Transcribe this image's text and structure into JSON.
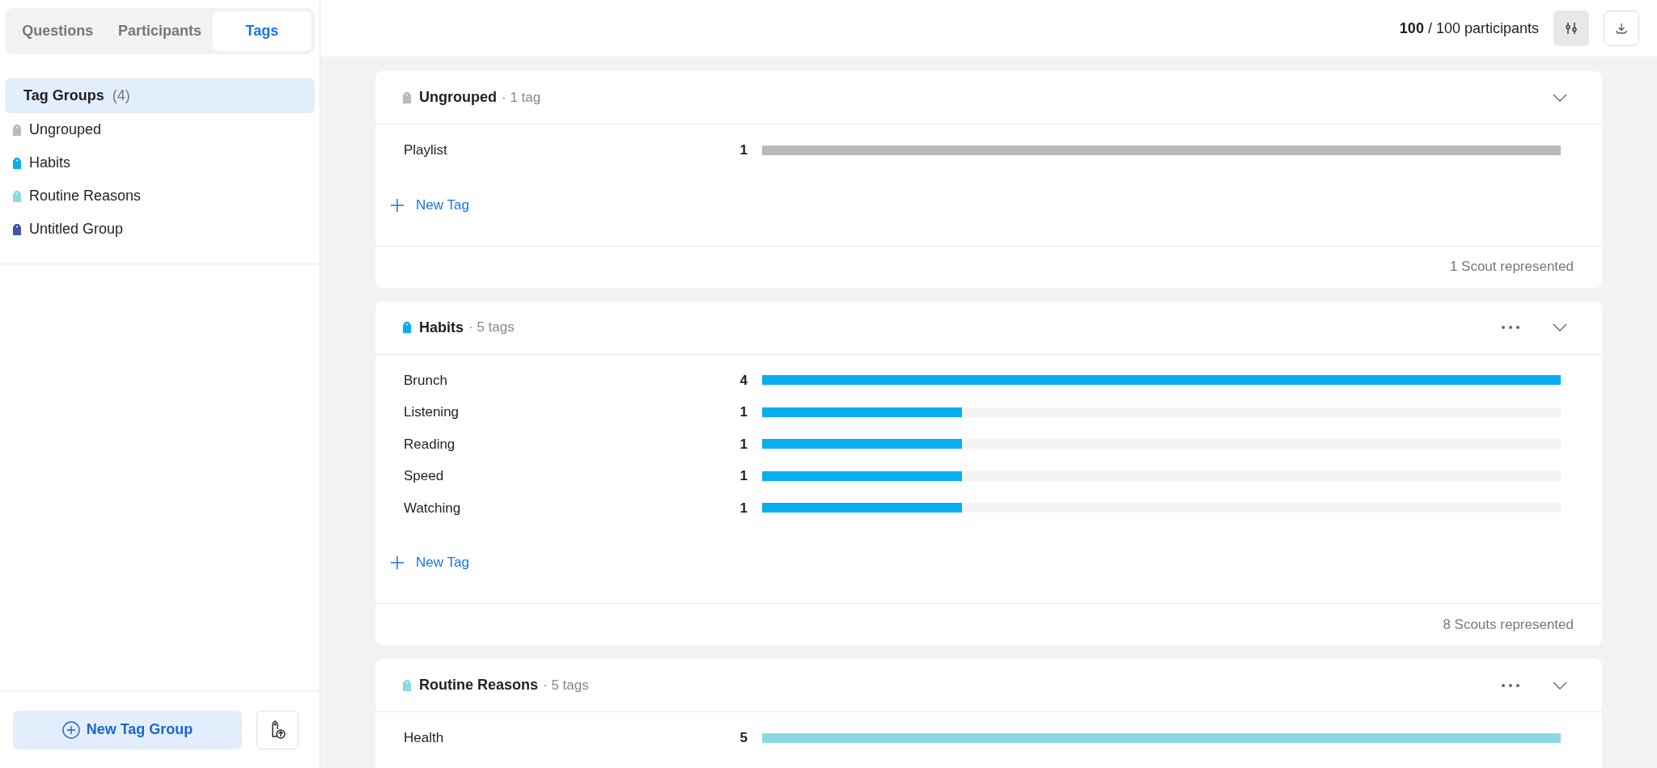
{
  "tabs": [
    {
      "label": "Questions",
      "selected": false
    },
    {
      "label": "Participants",
      "selected": false
    },
    {
      "label": "Tags",
      "selected": true
    }
  ],
  "sidebar": {
    "heading": {
      "label": "Tag Groups",
      "count": "(4)",
      "selected": true
    },
    "groups": [
      {
        "name": "Ungrouped",
        "color": "#bababa"
      },
      {
        "name": "Habits",
        "color": "#08aef0"
      },
      {
        "name": "Routine Reasons",
        "color": "#8cd9e4"
      },
      {
        "name": "Untitled Group",
        "color": "#3f56a5"
      }
    ],
    "new_group_button": "New Tag Group"
  },
  "header": {
    "shown": "100",
    "total": "/ 100 participants"
  },
  "groups": [
    {
      "name": "Ungrouped",
      "tag_count": "· 1 tag",
      "color": "#bababa",
      "has_menu": false,
      "tags": [
        {
          "label": "Playlist",
          "count": "1",
          "level": 1
        }
      ],
      "new_tag": "New Tag",
      "footer": "1 Scout represented"
    },
    {
      "name": "Habits",
      "tag_count": "· 5 tags",
      "color": "#08aef0",
      "has_menu": true,
      "tags": [
        {
          "label": "Brunch",
          "count": "4",
          "level": 1
        },
        {
          "label": "Listening",
          "count": "1",
          "level": 0.25
        },
        {
          "label": "Reading",
          "count": "1",
          "level": 0.25
        },
        {
          "label": "Speed",
          "count": "1",
          "level": 0.25
        },
        {
          "label": "Watching",
          "count": "1",
          "level": 0.25
        }
      ],
      "new_tag": "New Tag",
      "footer": "8 Scouts represented"
    },
    {
      "name": "Routine Reasons",
      "tag_count": "· 5 tags",
      "color": "#8cd9e4",
      "has_menu": true,
      "tags": [
        {
          "label": "Health",
          "count": "5",
          "level": 1
        }
      ]
    }
  ]
}
